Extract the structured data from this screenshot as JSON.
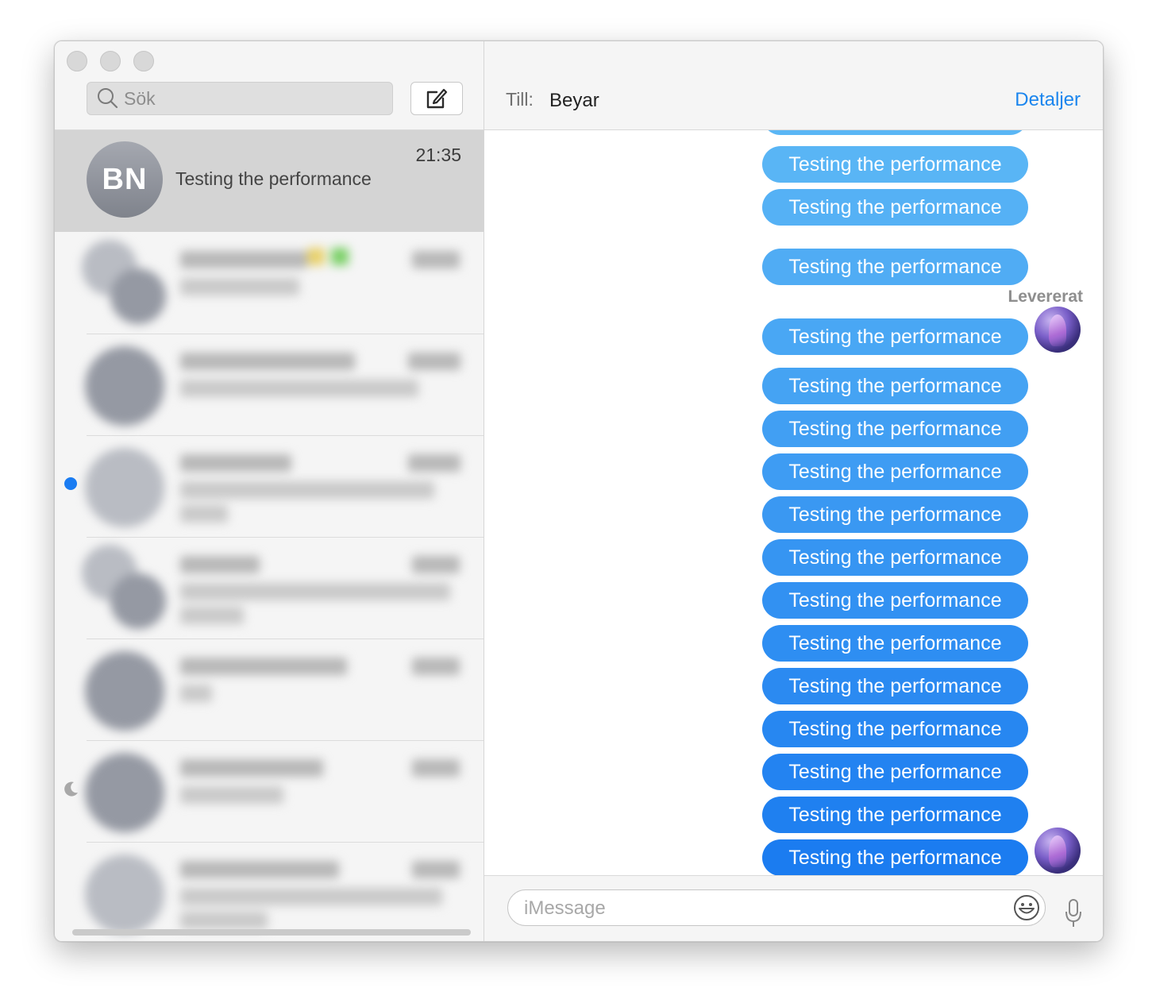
{
  "search": {
    "placeholder": "Sök"
  },
  "conversation_active": {
    "initials": "BN",
    "time": "21:35",
    "preview": "Testing the performance"
  },
  "header": {
    "to_label": "Till:",
    "recipient": "Beyar",
    "details_label": "Detaljer"
  },
  "messages": [
    {
      "text": "Testing the performance"
    },
    {
      "text": "Testing the performance"
    },
    {
      "text": "Testing the performance"
    },
    {
      "text": "Testing the performance"
    },
    {
      "text": "Testing the performance"
    },
    {
      "text": "Testing the performance"
    },
    {
      "text": "Testing the performance"
    },
    {
      "text": "Testing the performance"
    },
    {
      "text": "Testing the performance"
    },
    {
      "text": "Testing the performance"
    },
    {
      "text": "Testing the performance"
    },
    {
      "text": "Testing the performance"
    },
    {
      "text": "Testing the performance"
    },
    {
      "text": "Testing the performance"
    },
    {
      "text": "Testing the performance"
    },
    {
      "text": "Testing the performance"
    }
  ],
  "status": {
    "delivered": "Levererat"
  },
  "composer": {
    "placeholder": "iMessage"
  },
  "colors": {
    "accent": "#1a85ee",
    "bubble_top": "#5ab6f5",
    "bubble_bottom": "#1b7cf0",
    "unread": "#1a7cf2"
  }
}
